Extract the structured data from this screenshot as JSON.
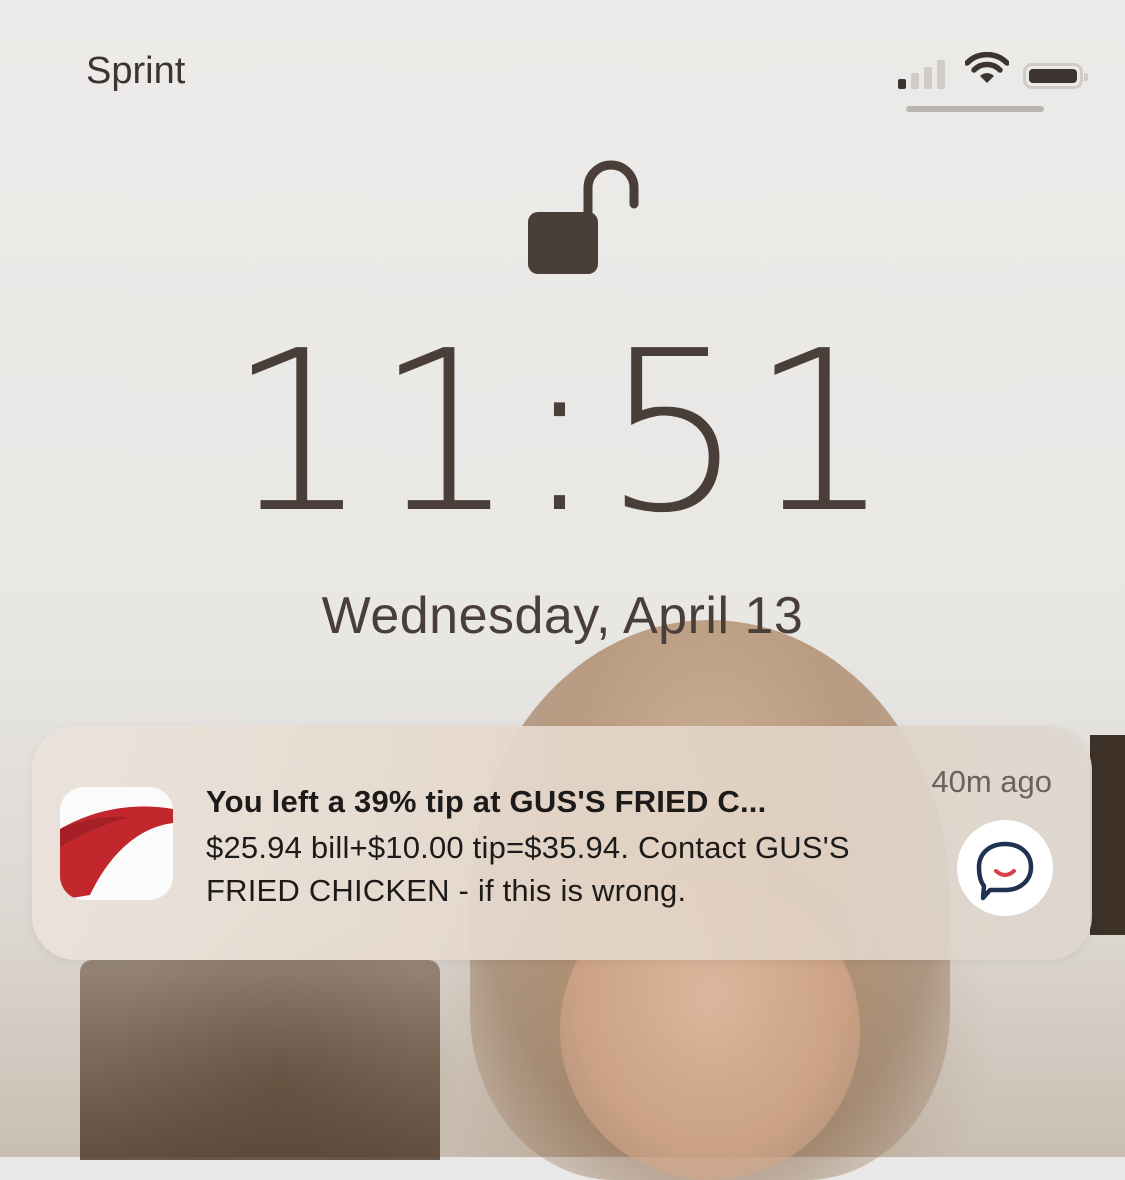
{
  "status_bar": {
    "carrier": "Sprint",
    "signal_bars_filled": 1,
    "signal_bars_total": 4,
    "wifi": "wifi-icon",
    "battery_level": 1.0
  },
  "lock_screen": {
    "lock_state": "unlocked",
    "lock_icon": "open-padlock-icon",
    "time": "11:51",
    "date": "Wednesday, April 13"
  },
  "notification": {
    "app_icon": "capital-one-swoosh-icon",
    "title": "You left a 39% tip at GUS'S FRIED C...",
    "body": "$25.94 bill+$10.00 tip=$35.94. Contact GUS'S FRIED CHICKEN - if this is wrong.",
    "time_ago": "40m ago",
    "action_icon": "chat-bubble-icon"
  },
  "colors": {
    "text_primary": "#4a3f38",
    "notif_text": "#1d1b1a",
    "brand_red": "#c1272d",
    "chat_navy": "#1f3350",
    "chat_smile": "#d8404a"
  }
}
